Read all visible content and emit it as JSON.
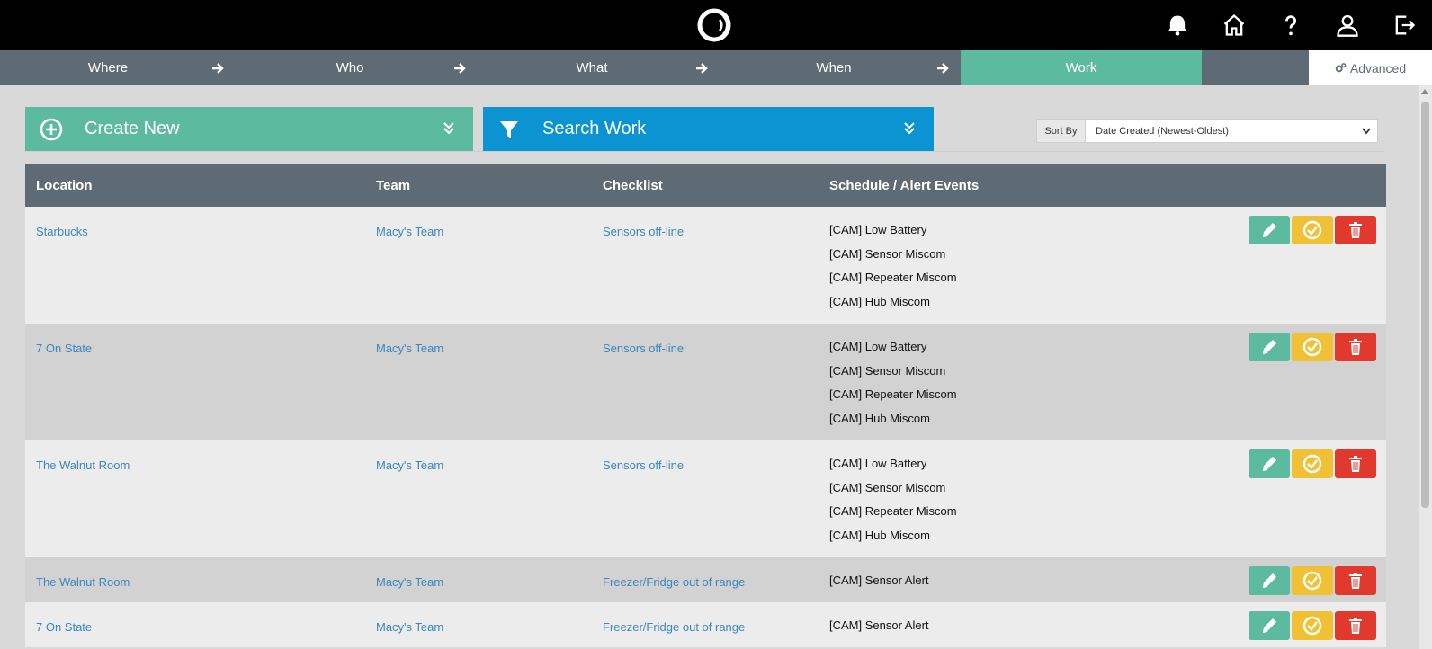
{
  "nav": {
    "steps": [
      {
        "label": "Where"
      },
      {
        "label": "Who"
      },
      {
        "label": "What"
      },
      {
        "label": "When"
      },
      {
        "label": "Work"
      }
    ],
    "active_step": "Work",
    "advanced_label": "Advanced"
  },
  "topbar_icons": [
    "bell-icon",
    "home-icon",
    "help-icon",
    "user-icon",
    "logout-icon"
  ],
  "actions": {
    "create_label": "Create New",
    "search_label": "Search Work"
  },
  "sort": {
    "label": "Sort By",
    "selected": "Date Created (Newest-Oldest)"
  },
  "table": {
    "headers": [
      "Location",
      "Team",
      "Checklist",
      "Schedule / Alert Events"
    ],
    "rows": [
      {
        "location": "Starbucks",
        "team": "Macy's Team",
        "checklist": "Sensors off-line",
        "events": [
          "[CAM] Low Battery",
          "[CAM] Sensor Miscom",
          "[CAM] Repeater Miscom",
          "[CAM] Hub Miscom"
        ]
      },
      {
        "location": "7 On State",
        "team": "Macy's Team",
        "checklist": "Sensors off-line",
        "events": [
          "[CAM] Low Battery",
          "[CAM] Sensor Miscom",
          "[CAM] Repeater Miscom",
          "[CAM] Hub Miscom"
        ]
      },
      {
        "location": "The Walnut Room",
        "team": "Macy's Team",
        "checklist": "Sensors off-line",
        "events": [
          "[CAM] Low Battery",
          "[CAM] Sensor Miscom",
          "[CAM] Repeater Miscom",
          "[CAM] Hub Miscom"
        ]
      },
      {
        "location": "The Walnut Room",
        "team": "Macy's Team",
        "checklist": "Freezer/Fridge out of range",
        "events": [
          "[CAM] Sensor Alert"
        ]
      },
      {
        "location": "7 On State",
        "team": "Macy's Team",
        "checklist": "Freezer/Fridge out of range",
        "events": [
          "[CAM] Sensor Alert"
        ]
      }
    ]
  },
  "colors": {
    "green": "#5cbb9e",
    "blue": "#0b94d1",
    "yellow": "#f0c135",
    "red": "#e2392e",
    "slate": "#5f6b74",
    "link": "#3b86bf"
  }
}
